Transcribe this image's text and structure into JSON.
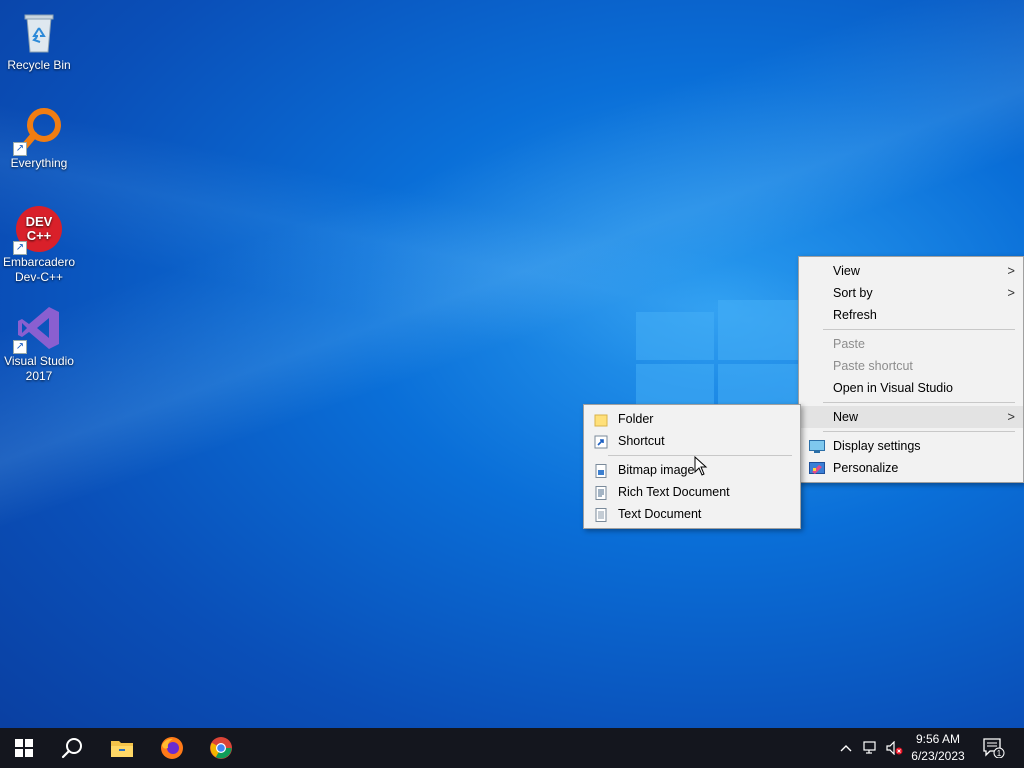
{
  "desktop_icons": [
    {
      "name": "recycle-bin",
      "label": "Recycle Bin",
      "shortcut": false
    },
    {
      "name": "everything",
      "label": "Everything",
      "shortcut": true
    },
    {
      "name": "devcpp",
      "label": "Embarcadero Dev-C++",
      "shortcut": true,
      "badge_line1": "DEV",
      "badge_line2": "C++"
    },
    {
      "name": "visual-studio",
      "label": "Visual Studio 2017",
      "shortcut": true
    }
  ],
  "context_menu": {
    "items": [
      {
        "label": "View",
        "submenu": true,
        "disabled": false
      },
      {
        "label": "Sort by",
        "submenu": true,
        "disabled": false
      },
      {
        "label": "Refresh",
        "submenu": false,
        "disabled": false
      },
      {
        "label": "Paste",
        "submenu": false,
        "disabled": true
      },
      {
        "label": "Paste shortcut",
        "submenu": false,
        "disabled": true
      },
      {
        "label": "Open in Visual Studio",
        "submenu": false,
        "disabled": false
      },
      {
        "label": "New",
        "submenu": true,
        "disabled": false,
        "highlighted": true
      },
      {
        "label": "Display settings",
        "submenu": false,
        "disabled": false,
        "icon": "display-icon"
      },
      {
        "label": "Personalize",
        "submenu": false,
        "disabled": false,
        "icon": "personalize-icon"
      }
    ]
  },
  "new_submenu": {
    "items": [
      {
        "label": "Folder",
        "icon": "folder-icon"
      },
      {
        "label": "Shortcut",
        "icon": "shortcut-icon"
      },
      {
        "label": "Bitmap image",
        "icon": "bitmap-icon"
      },
      {
        "label": "Rich Text Document",
        "icon": "rtf-icon"
      },
      {
        "label": "Text Document",
        "icon": "text-document-icon"
      }
    ]
  },
  "taskbar": {
    "time": "9:56 AM",
    "date": "6/23/2023",
    "notification_count": "1",
    "pinned": [
      "file-explorer-icon",
      "firefox-icon",
      "chrome-icon"
    ]
  },
  "colors": {
    "accent": "#0a6fd8",
    "menu_bg": "#f2f2f2",
    "taskbar_bg": "#14161e"
  }
}
